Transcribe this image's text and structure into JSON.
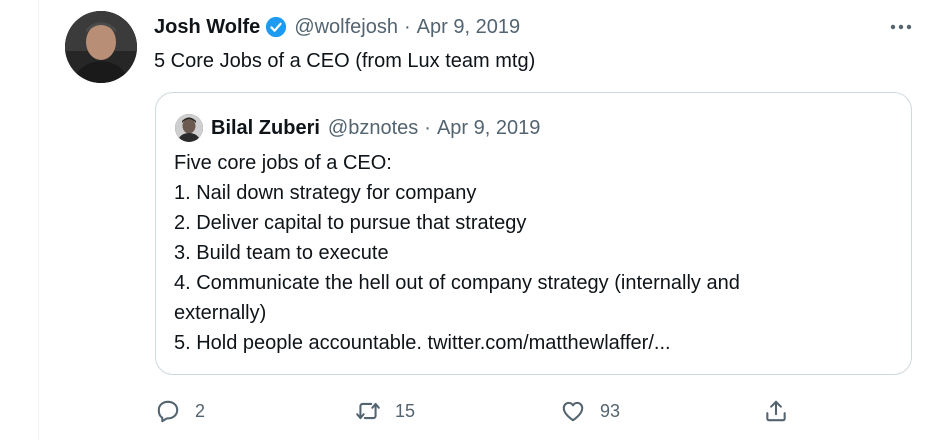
{
  "tweet": {
    "author_name": "Josh Wolfe",
    "handle": "@wolfejosh",
    "separator": "·",
    "date": "Apr 9, 2019",
    "text": "5 Core Jobs of a CEO (from Lux team mtg)"
  },
  "quoted": {
    "author_name": "Bilal Zuberi",
    "handle": "@bznotes",
    "separator": "·",
    "date": "Apr 9, 2019",
    "lines": [
      "Five core jobs of a CEO:",
      "1. Nail down strategy for company",
      "2. Deliver capital to pursue that strategy",
      "3. Build team to execute",
      "4. Communicate the hell out of company strategy (internally and",
      "externally)",
      "5. Hold people accountable. twitter.com/matthewlaffer/..."
    ]
  },
  "actions": {
    "reply_count": "2",
    "retweet_count": "15",
    "like_count": "93"
  },
  "icons": {
    "verified": "verified-badge-icon",
    "more": "more-icon",
    "reply": "reply-icon",
    "retweet": "retweet-icon",
    "like": "like-icon",
    "share": "share-icon"
  },
  "colors": {
    "text": "#0f1419",
    "secondary": "#536471",
    "verified": "#1d9bf0",
    "border": "#cfd9de"
  }
}
